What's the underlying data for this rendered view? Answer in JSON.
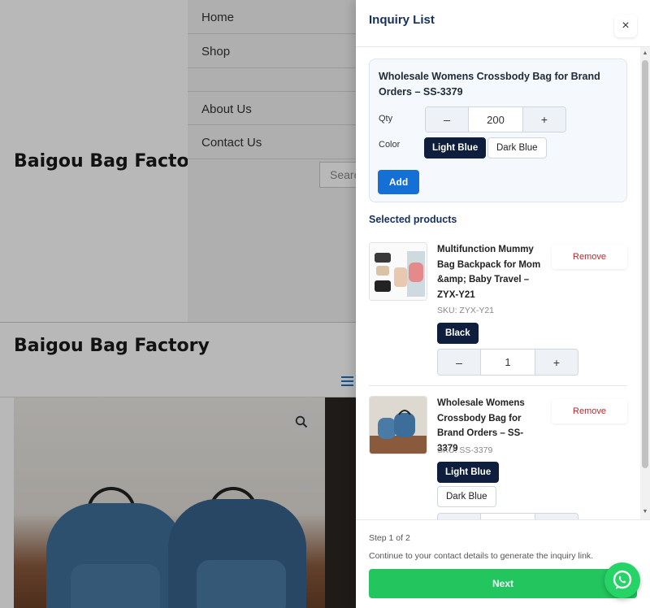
{
  "site": {
    "brand": "Baigou Bag Factory",
    "brand_secondary": "Baigou Bag Factory",
    "menu": [
      "Home",
      "Shop",
      "About Us",
      "Contact Us"
    ],
    "search_placeholder": "Search"
  },
  "drawer": {
    "title": "Inquiry List",
    "close_label": "×",
    "quick_add": {
      "product_name": "Wholesale Womens Crossbody Bag for Brand Orders – SS-3379",
      "qty_label": "Qty",
      "qty_value": "200",
      "color_label": "Color",
      "colors": [
        "Light Blue",
        "Dark Blue"
      ],
      "selected_color": "Light Blue",
      "add_label": "Add"
    },
    "selected_heading": "Selected products",
    "items": [
      {
        "name": "Multifunction Mummy Bag Backpack for Mom &amp; Baby Travel – ZYX-Y21",
        "sku": "SKU: ZYX-Y21",
        "colors": [
          "Black"
        ],
        "selected_color": "Black",
        "qty": "1",
        "remove_label": "Remove"
      },
      {
        "name": "Wholesale Womens Crossbody Bag for Brand Orders – SS-3379",
        "sku": "SKU: SS-3379",
        "colors": [
          "Light Blue",
          "Dark Blue"
        ],
        "selected_color": "Light Blue",
        "qty": "",
        "remove_label": "Remove"
      }
    ],
    "stepper_minus": "–",
    "stepper_plus": "+",
    "footer": {
      "step": "Step 1 of 2",
      "note": "Continue to your contact details to generate the inquiry link.",
      "next_label": "Next"
    }
  },
  "colors": {
    "primary_blue": "#1570d6",
    "navy_chip": "#0f1e3d",
    "next_green": "#22c55e",
    "remove_red": "#c0262d",
    "title_navy": "#16305e",
    "whatsapp": "#25d366"
  },
  "icons": [
    "search-icon",
    "close-icon",
    "menu-icon",
    "whatsapp-icon"
  ]
}
